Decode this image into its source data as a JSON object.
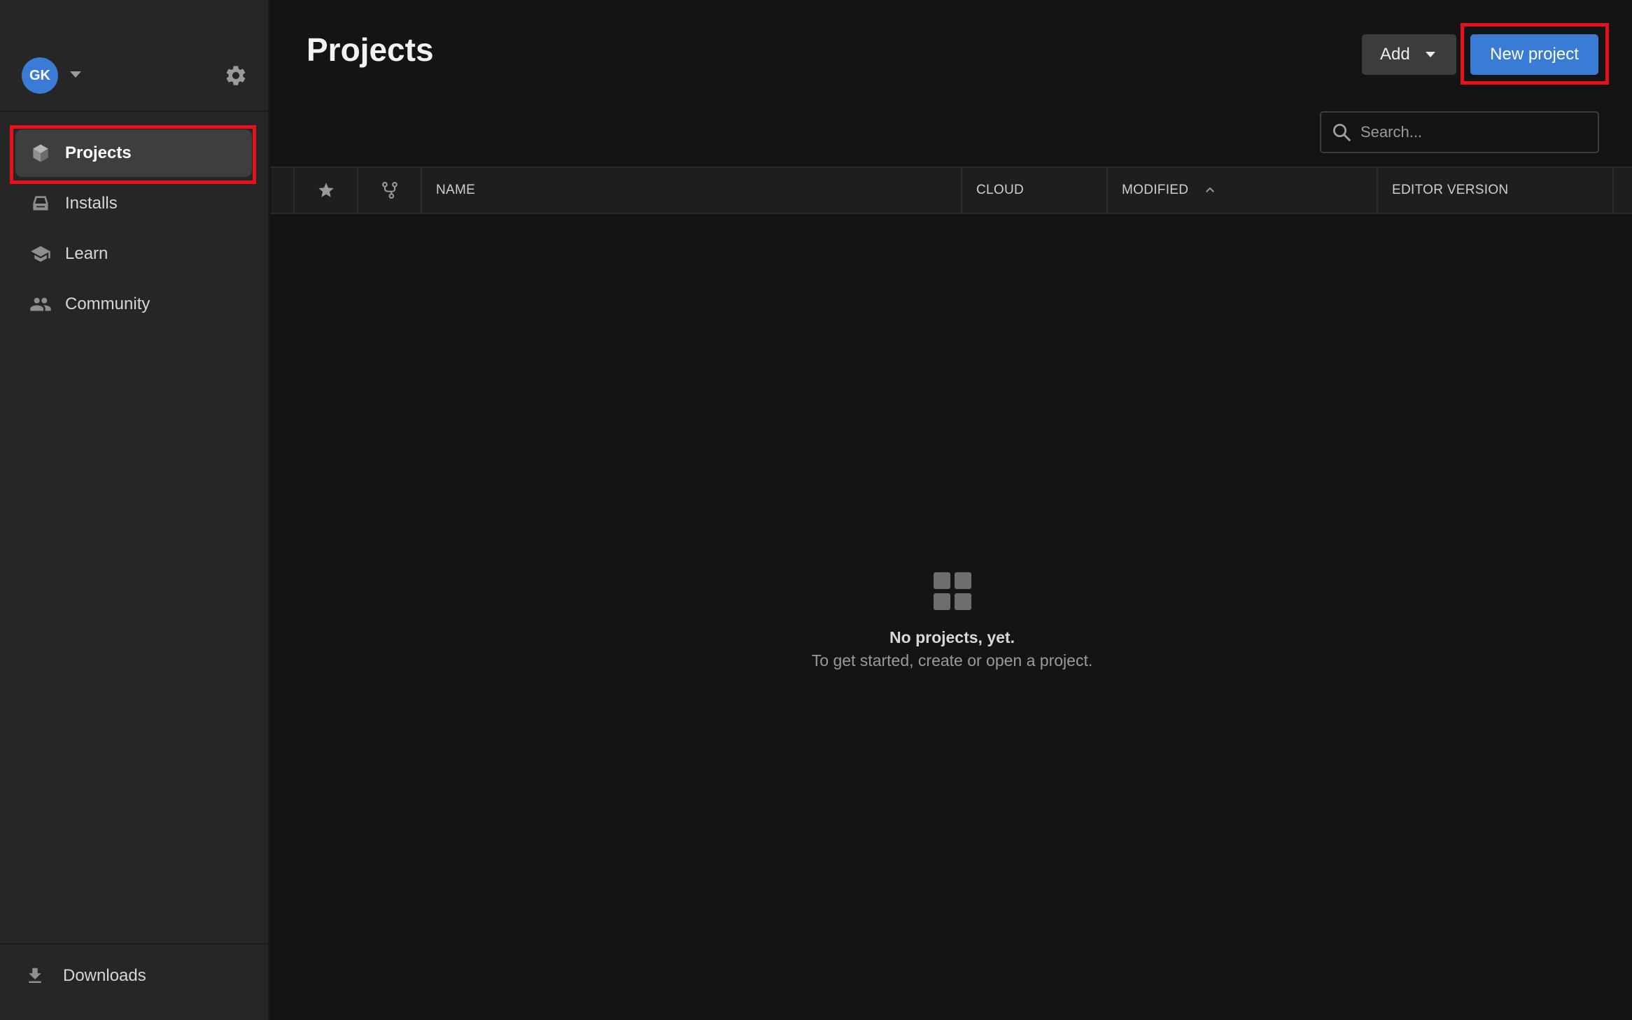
{
  "user": {
    "initials": "GK"
  },
  "sidebar": {
    "items": [
      {
        "label": "Projects",
        "icon": "cube-icon",
        "active": true
      },
      {
        "label": "Installs",
        "icon": "drive-icon",
        "active": false
      },
      {
        "label": "Learn",
        "icon": "graduation-cap-icon",
        "active": false
      },
      {
        "label": "Community",
        "icon": "people-icon",
        "active": false
      }
    ],
    "footer": {
      "downloads_label": "Downloads"
    }
  },
  "header": {
    "title": "Projects",
    "add_label": "Add",
    "new_project_label": "New project"
  },
  "search": {
    "placeholder": "Search...",
    "value": ""
  },
  "table": {
    "columns": [
      "NAME",
      "CLOUD",
      "MODIFIED",
      "EDITOR VERSION"
    ],
    "sorted_column": "MODIFIED",
    "sort_direction": "ascending",
    "rows": []
  },
  "empty_state": {
    "title": "No projects, yet.",
    "subtitle": "To get started, create or open a project."
  },
  "highlights": [
    "sidebar-item-projects",
    "new-project-button"
  ],
  "colors": {
    "accent": "#3a7bd5",
    "highlight": "#e8101a",
    "sidebar_bg": "#262626",
    "main_bg": "#141414"
  }
}
